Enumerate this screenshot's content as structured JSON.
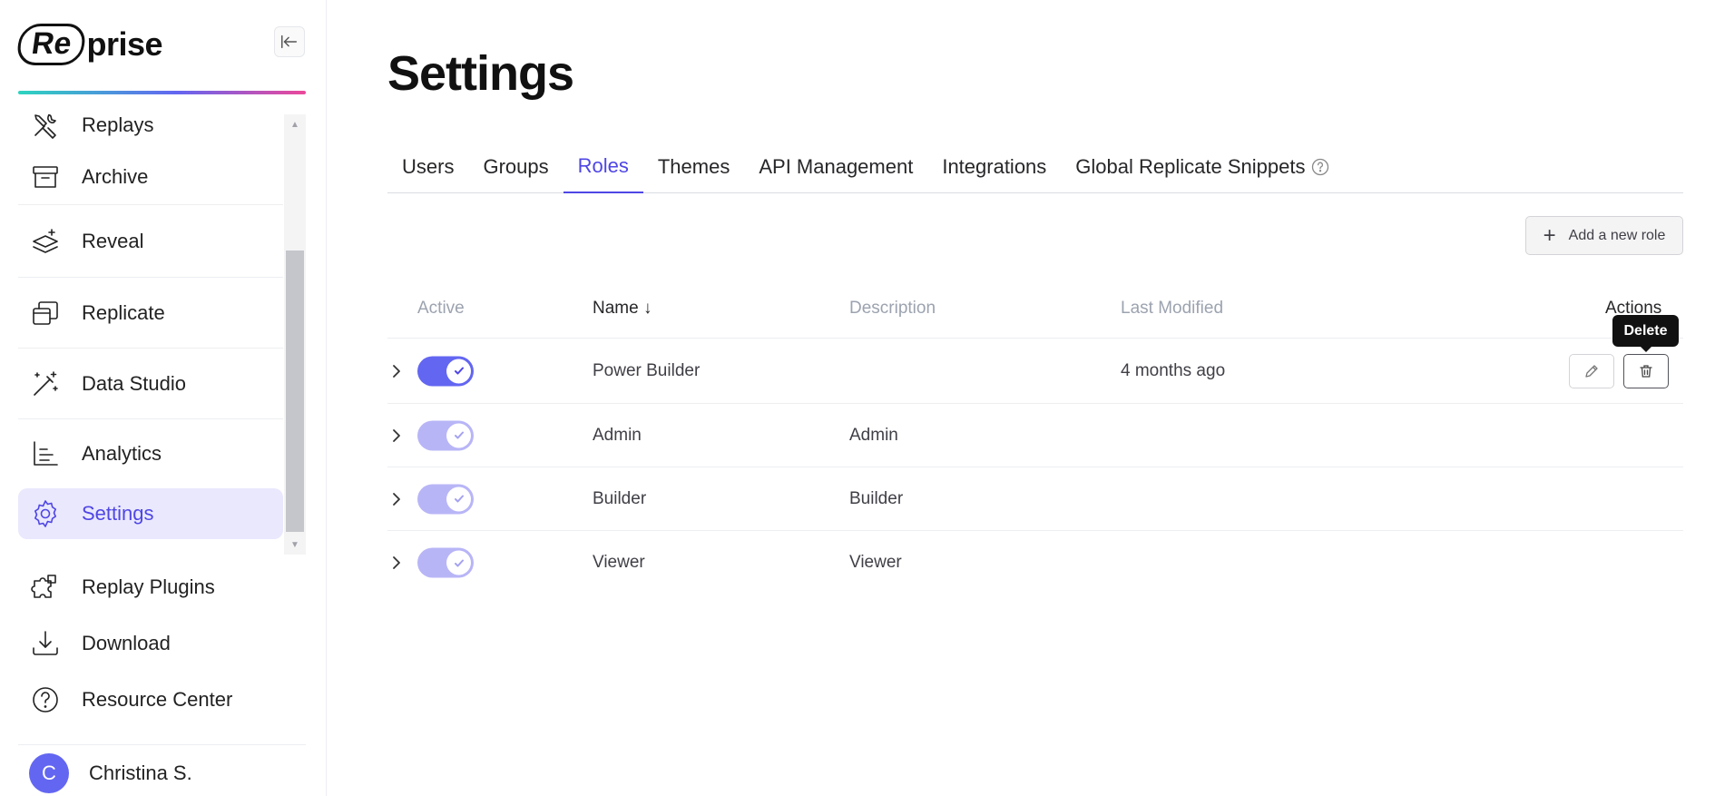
{
  "app": {
    "logo": {
      "part1": "Re",
      "slash": "/",
      "part2": "prise"
    }
  },
  "sidebar": {
    "items": [
      {
        "label": "Replays",
        "icon": "tools-icon"
      },
      {
        "label": "Archive",
        "icon": "archive-box-icon"
      },
      {
        "label": "Reveal",
        "icon": "layers-sparkle-icon"
      },
      {
        "label": "Replicate",
        "icon": "windows-stack-icon"
      },
      {
        "label": "Data Studio",
        "icon": "magic-wand-icon"
      },
      {
        "label": "Analytics",
        "icon": "bar-chart-icon"
      },
      {
        "label": "Settings",
        "icon": "gear-icon",
        "active": true
      }
    ],
    "bottom_items": [
      {
        "label": "Replay Plugins",
        "icon": "puzzle-icon"
      },
      {
        "label": "Download",
        "icon": "download-icon"
      },
      {
        "label": "Resource Center",
        "icon": "question-circle-icon"
      }
    ],
    "user": {
      "initial": "C",
      "name": "Christina S."
    }
  },
  "main": {
    "title": "Settings",
    "tabs": [
      {
        "label": "Users"
      },
      {
        "label": "Groups"
      },
      {
        "label": "Roles",
        "active": true
      },
      {
        "label": "Themes"
      },
      {
        "label": "API Management"
      },
      {
        "label": "Integrations"
      },
      {
        "label": "Global Replicate Snippets"
      }
    ],
    "add_role_label": "Add a new role",
    "table": {
      "headers": {
        "active": "Active",
        "name": "Name",
        "name_sort": "↓",
        "description": "Description",
        "last_modified": "Last Modified",
        "actions": "Actions"
      },
      "rows": [
        {
          "name": "Power Builder",
          "description": "",
          "last_modified": "4 months ago",
          "active": true,
          "editable": true
        },
        {
          "name": "Admin",
          "description": "Admin",
          "last_modified": "",
          "active": true,
          "editable": false
        },
        {
          "name": "Builder",
          "description": "Builder",
          "last_modified": "",
          "active": true,
          "editable": false
        },
        {
          "name": "Viewer",
          "description": "Viewer",
          "last_modified": "",
          "active": true,
          "editable": false
        }
      ]
    },
    "tooltip": "Delete"
  },
  "colors": {
    "accent": "#4f46e5",
    "toggle_on": "#6366f1",
    "toggle_disabled": "#b8b5f7",
    "active_nav_bg": "#e9e8fd"
  }
}
